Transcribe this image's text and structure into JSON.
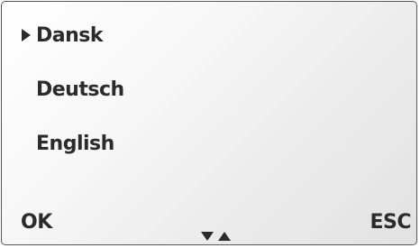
{
  "menu": {
    "selected_index": 0,
    "items": [
      {
        "label": "Dansk"
      },
      {
        "label": "Deutsch"
      },
      {
        "label": "English"
      }
    ]
  },
  "softkeys": {
    "left_label": "OK",
    "right_label": "ESC"
  },
  "icons": {
    "selector": "triangle-right-icon",
    "scroll_down": "arrow-down-icon",
    "scroll_up": "arrow-up-icon"
  },
  "colors": {
    "text": "#2b2b2b",
    "border": "#555555"
  }
}
